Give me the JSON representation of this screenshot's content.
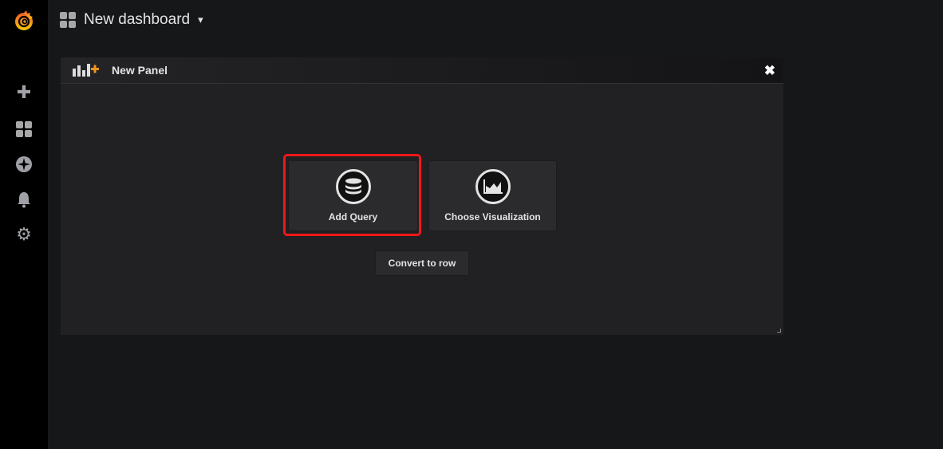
{
  "sidebar": {
    "items": [
      {
        "icon": "grafana-logo-icon"
      },
      {
        "icon": "plus-icon",
        "glyph": "✚"
      },
      {
        "icon": "dashboards-icon"
      },
      {
        "icon": "explore-compass-icon",
        "glyph": "✵"
      },
      {
        "icon": "bell-icon",
        "glyph": "🔔"
      },
      {
        "icon": "gear-icon",
        "glyph": "⚙"
      }
    ]
  },
  "header": {
    "title": "New dashboard",
    "caret": "▾"
  },
  "panel": {
    "title": "New Panel",
    "close": "✖",
    "add_query": "Add Query",
    "choose_visualization": "Choose Visualization",
    "convert_to_row": "Convert to row"
  },
  "colors": {
    "highlight": "#f01818",
    "logo": "#f46800"
  }
}
